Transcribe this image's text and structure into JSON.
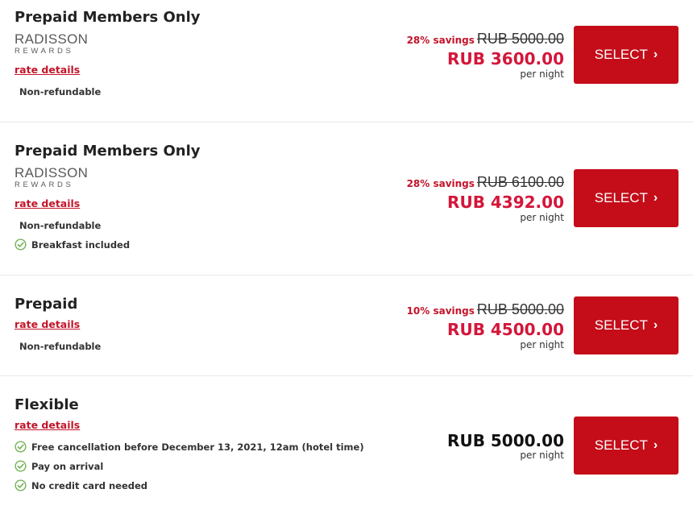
{
  "rates": [
    {
      "title": "Prepaid Members Only",
      "logo": {
        "line1": "RADISSON",
        "line2": "REWARDS"
      },
      "rate_details": "rate details",
      "features": [
        "Non-refundable"
      ],
      "savings": "28% savings",
      "original_price": "RUB 5000.00",
      "price": "RUB 3600.00",
      "per_night": "per night",
      "select_label": "SELECT"
    },
    {
      "title": "Prepaid Members Only",
      "logo": {
        "line1": "RADISSON",
        "line2": "REWARDS"
      },
      "rate_details": "rate details",
      "features": [
        "Non-refundable",
        "Breakfast included"
      ],
      "savings": "28% savings",
      "original_price": "RUB 6100.00",
      "price": "RUB 4392.00",
      "per_night": "per night",
      "select_label": "SELECT"
    },
    {
      "title": "Prepaid",
      "rate_details": "rate details",
      "features": [
        "Non-refundable"
      ],
      "savings": "10% savings",
      "original_price": "RUB 5000.00",
      "price": "RUB 4500.00",
      "per_night": "per night",
      "select_label": "SELECT"
    },
    {
      "title": "Flexible",
      "rate_details": "rate details",
      "features": [
        "Free cancellation before December 13, 2021, 12am (hotel time)",
        "Pay on arrival",
        "No credit card needed"
      ],
      "price": "RUB 5000.00",
      "per_night": "per night",
      "select_label": "SELECT"
    }
  ],
  "colors": {
    "accent": "#c40d19",
    "sale_price": "#d4163a",
    "check": "#6ab04c"
  },
  "icons": {
    "check": "check-circle-icon",
    "arrow": "chevron-right-icon"
  }
}
